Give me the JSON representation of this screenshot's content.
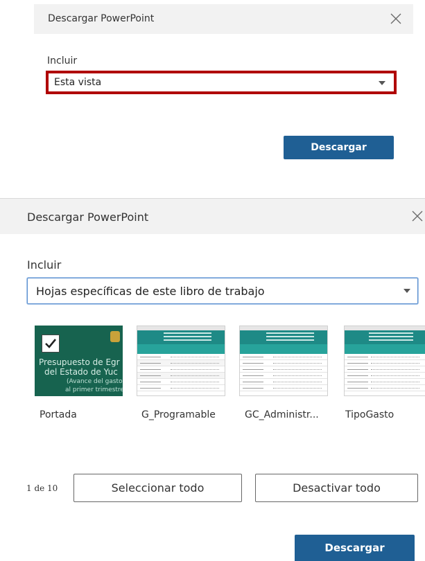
{
  "dialog_top": {
    "title": "Descargar PowerPoint",
    "include_label": "Incluir",
    "select_value": "Esta vista",
    "download_label": "Descargar"
  },
  "dialog_bottom": {
    "title": "Descargar PowerPoint",
    "include_label": "Incluir",
    "select_value": "Hojas específicas de este libro de trabajo",
    "sheets": [
      {
        "label": "Portada",
        "selected": true,
        "cover_lines": [
          "Presupuesto de Egr",
          "del Estado de Yuc",
          "(Avance del gasto",
          "al primer trimestre"
        ]
      },
      {
        "label": "G_Programable",
        "selected": false
      },
      {
        "label": "GC_Administr...",
        "selected": false
      },
      {
        "label": "TipoGasto",
        "selected": false
      }
    ],
    "page_count": "1 de 10",
    "select_all_label": "Seleccionar todo",
    "deselect_all_label": "Desactivar todo",
    "download_label": "Descargar"
  },
  "colors": {
    "highlight_border": "#b00000",
    "primary_button": "#1f5f94",
    "cover_background": "#17634f",
    "sheet_header": "#1e8a86",
    "focus_border": "#5b8fcf"
  }
}
